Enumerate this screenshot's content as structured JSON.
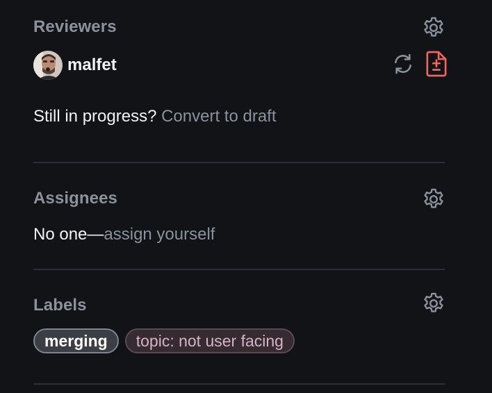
{
  "reviewers": {
    "title": "Reviewers",
    "reviewer_name": "malfet",
    "draft_prompt": "Still in progress?",
    "draft_link": "Convert to draft"
  },
  "assignees": {
    "title": "Assignees",
    "empty_text": "No one—",
    "assign_link": "assign yourself"
  },
  "labels": {
    "title": "Labels",
    "items": [
      {
        "name": "merging",
        "color": "#3b3f45"
      },
      {
        "name": "topic: not user facing",
        "color": "#352b31"
      }
    ]
  },
  "icons": {
    "settings": "gear-icon",
    "rerequest": "sync-icon",
    "changes_requested": "file-diff-icon"
  },
  "colors": {
    "background": "#111317",
    "muted_text": "#8b929b",
    "changes_requested": "#f0665a"
  }
}
